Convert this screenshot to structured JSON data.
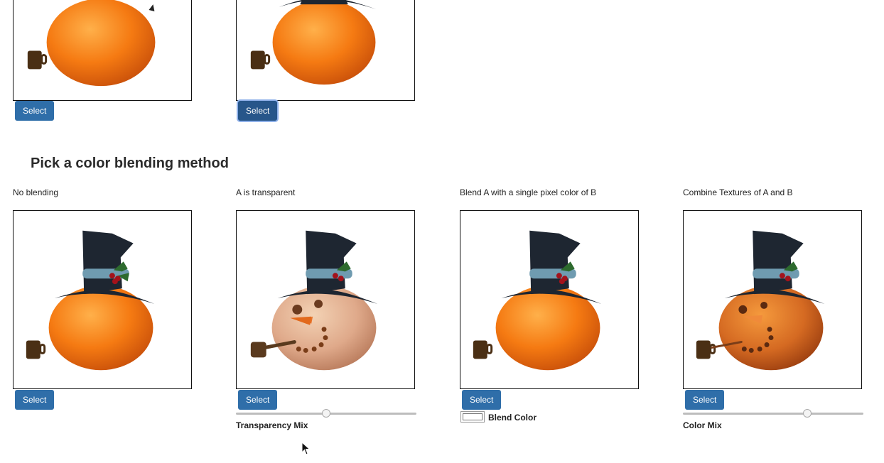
{
  "top_row": {
    "select_buttons": [
      "Select",
      "Select"
    ]
  },
  "section_title": "Pick a color blending method",
  "methods": [
    {
      "label": "No blending",
      "button": "Select"
    },
    {
      "label": "A is transparent",
      "button": "Select",
      "control_caption": "Transparency Mix",
      "slider_value": 0.5
    },
    {
      "label": "Blend A with a single pixel color of B",
      "button": "Select",
      "control_caption": "Blend Color",
      "swatch_color": "#ffffff"
    },
    {
      "label": "Combine Textures of A and B",
      "button": "Select",
      "control_caption": "Color Mix",
      "slider_value": 0.69
    }
  ],
  "colors": {
    "button": "#2f6ea9",
    "button_active": "#27568a",
    "orange": "#f07a1a",
    "hat": "#1e2631",
    "scarf": "#6f9bb0",
    "pipe": "#5a3a1e"
  }
}
